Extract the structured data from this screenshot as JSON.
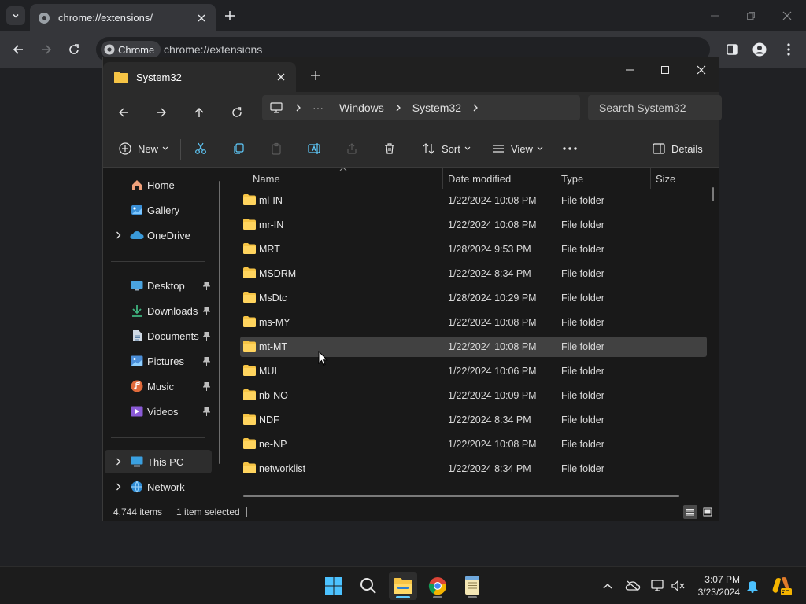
{
  "chrome": {
    "tab_title": "chrome://extensions/",
    "chip_label": "Chrome",
    "url": "chrome://extensions"
  },
  "explorer": {
    "tab_title": "System32",
    "breadcrumb": [
      "Windows",
      "System32"
    ],
    "breadcrumb_more": "···",
    "search_placeholder": "Search System32",
    "commands": {
      "new": "New",
      "sort": "Sort",
      "view": "View",
      "details": "Details"
    },
    "sidebar": {
      "top": [
        {
          "label": "Home",
          "icon": "home-icon"
        },
        {
          "label": "Gallery",
          "icon": "gallery-icon"
        },
        {
          "label": "OneDrive",
          "icon": "onedrive-icon"
        }
      ],
      "pinned": [
        {
          "label": "Desktop",
          "icon": "desktop-icon"
        },
        {
          "label": "Downloads",
          "icon": "downloads-icon"
        },
        {
          "label": "Documents",
          "icon": "documents-icon"
        },
        {
          "label": "Pictures",
          "icon": "pictures-icon"
        },
        {
          "label": "Music",
          "icon": "music-icon"
        },
        {
          "label": "Videos",
          "icon": "videos-icon"
        }
      ],
      "bottom": [
        {
          "label": "This PC",
          "icon": "this-pc-icon"
        },
        {
          "label": "Network",
          "icon": "network-icon"
        }
      ]
    },
    "columns": [
      "Name",
      "Date modified",
      "Type",
      "Size"
    ],
    "files": [
      {
        "name": "ml-IN",
        "date": "1/22/2024 10:08 PM",
        "type": "File folder"
      },
      {
        "name": "mr-IN",
        "date": "1/22/2024 10:08 PM",
        "type": "File folder"
      },
      {
        "name": "MRT",
        "date": "1/28/2024 9:53 PM",
        "type": "File folder"
      },
      {
        "name": "MSDRM",
        "date": "1/22/2024 8:34 PM",
        "type": "File folder"
      },
      {
        "name": "MsDtc",
        "date": "1/28/2024 10:29 PM",
        "type": "File folder"
      },
      {
        "name": "ms-MY",
        "date": "1/22/2024 10:08 PM",
        "type": "File folder"
      },
      {
        "name": "mt-MT",
        "date": "1/22/2024 10:08 PM",
        "type": "File folder"
      },
      {
        "name": "MUI",
        "date": "1/22/2024 10:06 PM",
        "type": "File folder"
      },
      {
        "name": "nb-NO",
        "date": "1/22/2024 10:09 PM",
        "type": "File folder"
      },
      {
        "name": "NDF",
        "date": "1/22/2024 8:34 PM",
        "type": "File folder"
      },
      {
        "name": "ne-NP",
        "date": "1/22/2024 10:08 PM",
        "type": "File folder"
      },
      {
        "name": "networklist",
        "date": "1/22/2024 8:34 PM",
        "type": "File folder"
      }
    ],
    "selected_file": "mt-MT",
    "status": {
      "items": "4,744 items",
      "selected": "1 item selected"
    }
  },
  "taskbar": {
    "time": "3:07 PM",
    "date": "3/23/2024"
  },
  "colors": {
    "folder": "#f6c445",
    "accent": "#60cdff",
    "selection": "#414141"
  }
}
